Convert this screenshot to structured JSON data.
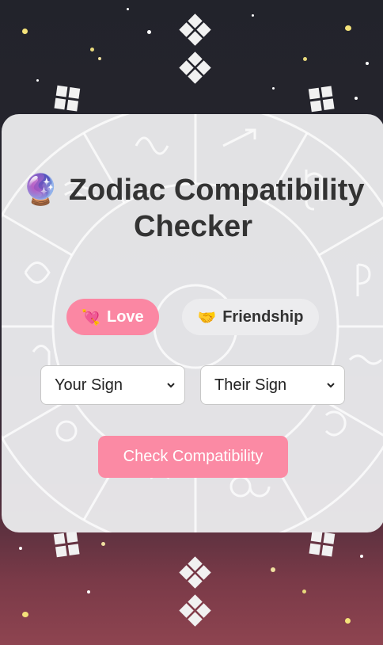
{
  "app": {
    "title_emoji": "🔮",
    "title": "Zodiac Compatibility Checker"
  },
  "tabs": [
    {
      "icon": "💘",
      "icon_name": "heart-arrow-icon",
      "label": "Love",
      "active": true
    },
    {
      "icon": "🤝",
      "icon_name": "handshake-icon",
      "label": "Friendship",
      "active": false
    }
  ],
  "form": {
    "sign1": {
      "selected": "Your Sign"
    },
    "sign2": {
      "selected": "Their Sign"
    },
    "submit_label": "Check Compatibility"
  },
  "colors": {
    "accent": "#fb87a3",
    "card": "#eaeaec",
    "text": "#333333"
  }
}
